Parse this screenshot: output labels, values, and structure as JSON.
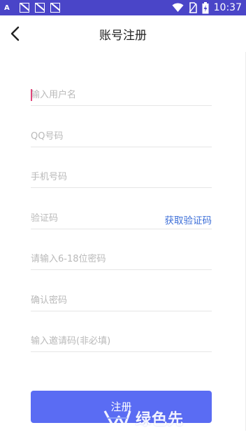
{
  "status_bar": {
    "time": "10:37",
    "left_icons": [
      "font-icon",
      "notification-icon",
      "notification-icon",
      "notification-icon"
    ],
    "right_icons": [
      "wifi-icon",
      "no-sim-icon",
      "battery-charging-icon"
    ]
  },
  "header": {
    "title": "账号注册",
    "back_icon": "chevron-left-icon"
  },
  "form": {
    "username_placeholder": "输入用户名",
    "qq_placeholder": "QQ号码",
    "phone_placeholder": "手机号码",
    "code_placeholder": "验证码",
    "get_code_label": "获取验证码",
    "password_placeholder": "请输入6-18位密码",
    "confirm_placeholder": "确认密码",
    "invite_placeholder": "输入邀请码(非必填)"
  },
  "register_button": {
    "label": "注册"
  },
  "watermark": {
    "text": "绿色先"
  },
  "colors": {
    "status_bar": "#4a45c8",
    "accent_link": "#3d6fd8",
    "button": "#5a6cf3",
    "cursor": "#e0467a"
  }
}
